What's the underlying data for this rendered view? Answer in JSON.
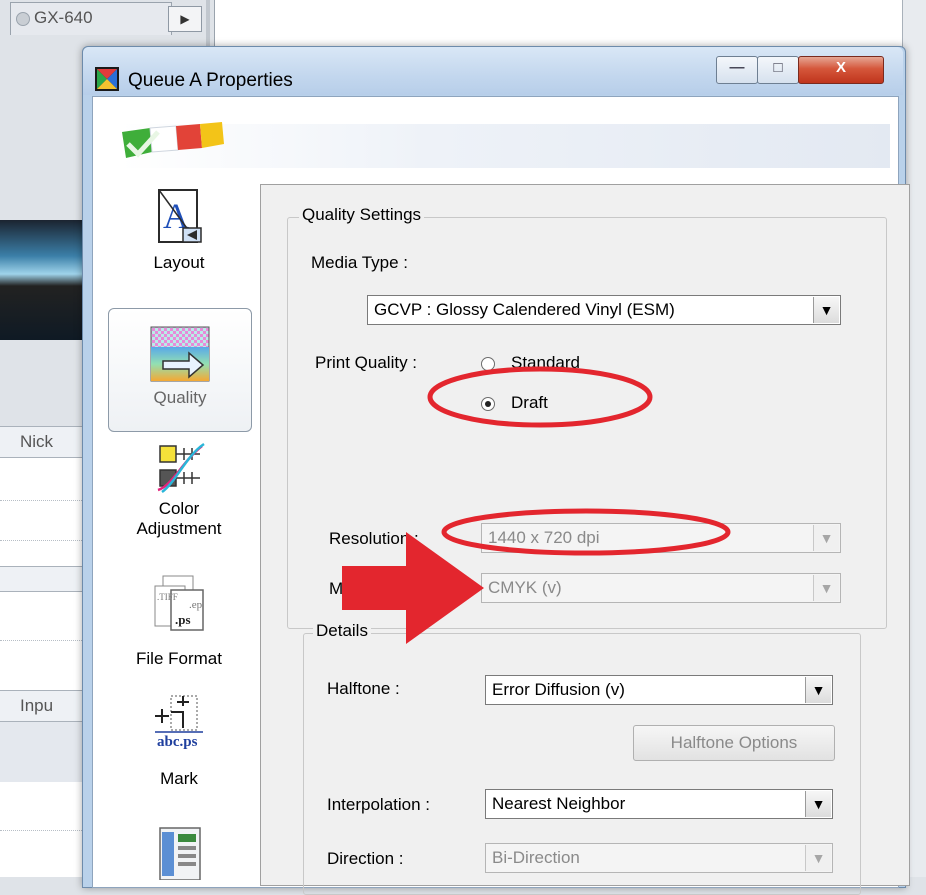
{
  "background": {
    "tab_label": "GX-640",
    "scroll_right_glyph": "▶",
    "column_nick": "Nick",
    "column_input": "Inpu"
  },
  "window": {
    "title": "Queue A Properties",
    "minimize_glyph": "—",
    "maximize_glyph": "□",
    "close_glyph": "X"
  },
  "nav": {
    "items": [
      {
        "label": "Layout",
        "icon": "layout-icon"
      },
      {
        "label": "Quality",
        "icon": "quality-icon",
        "selected": true
      },
      {
        "label": "Color Adjustment",
        "icon": "color-adjustment-icon"
      },
      {
        "label": "File Format",
        "icon": "file-format-icon"
      },
      {
        "label": "Mark",
        "icon": "mark-icon"
      },
      {
        "label": "",
        "icon": "printer-settings-icon"
      }
    ],
    "color_line1": "Color",
    "color_line2": "Adjustment",
    "file_format_glyph": ".ps",
    "mark_glyph": "abc.ps"
  },
  "quality_settings": {
    "group_label": "Quality Settings",
    "media_type_label": "Media Type :",
    "media_type_value": "GCVP : Glossy Calendered Vinyl (ESM)",
    "print_quality_label": "Print Quality :",
    "pq_standard": "Standard",
    "pq_draft": "Draft",
    "resolution_label": "Resolution :",
    "resolution_value": "1440 x 720 dpi",
    "mode_label": "Mode :",
    "mode_value": "CMYK (v)"
  },
  "details": {
    "group_label": "Details",
    "halftone_label": "Halftone :",
    "halftone_value": "Error Diffusion (v)",
    "halftone_options_button": "Halftone Options",
    "interpolation_label": "Interpolation :",
    "interpolation_value": "Nearest Neighbor",
    "direction_label": "Direction :",
    "direction_value": "Bi-Direction"
  },
  "combo_arrow": "▼",
  "annotation_color": "#e3262e"
}
